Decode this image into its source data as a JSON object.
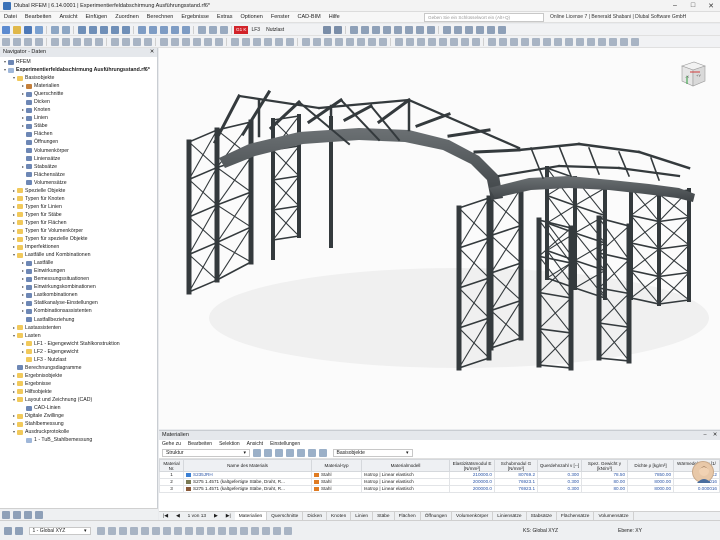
{
  "app": {
    "title": "Dlubal RFEM | 6.14.0001 | Experimentierfeldabschirmung Ausführungsstand.rf6*"
  },
  "menu": {
    "items": [
      "Datei",
      "Bearbeiten",
      "Ansicht",
      "Einfügen",
      "Zuordnen",
      "Berechnen",
      "Ergebnisse",
      "Extras",
      "Optionen",
      "Fenster",
      "CAD-BIM",
      "Hilfe"
    ]
  },
  "search": {
    "placeholder": "Geben Sie ein Schlüsselwort ein (Alt+Q)"
  },
  "license": "Online License 7 | Benerald Shabani | Dlubal Software GmbH",
  "loadcase": {
    "badge": "G1 K",
    "name": "LF3",
    "description": "Nutzlast"
  },
  "navigator": {
    "title": "Navigator - Daten",
    "tree": [
      {
        "label": "RFEM",
        "level": 0,
        "arrow": "v",
        "icon": "gen"
      },
      {
        "label": "Experimentierfeldabschirmung Ausführungsstand.rf6*",
        "level": 0,
        "arrow": "v",
        "icon": "doc",
        "bold": true
      },
      {
        "label": "Basisobjekte",
        "level": 1,
        "arrow": "v",
        "icon": "folder"
      },
      {
        "label": "Materialien",
        "level": 2,
        "arrow": ">",
        "icon": "mat"
      },
      {
        "label": "Querschnitte",
        "level": 2,
        "arrow": ">",
        "icon": "gen"
      },
      {
        "label": "Dicken",
        "level": 2,
        "arrow": "",
        "icon": "gen"
      },
      {
        "label": "Knoten",
        "level": 2,
        "arrow": ">",
        "icon": "gen"
      },
      {
        "label": "Linien",
        "level": 2,
        "arrow": ">",
        "icon": "gen"
      },
      {
        "label": "Stäbe",
        "level": 2,
        "arrow": ">",
        "icon": "gen"
      },
      {
        "label": "Flächen",
        "level": 2,
        "arrow": "",
        "icon": "gen"
      },
      {
        "label": "Öffnungen",
        "level": 2,
        "arrow": "",
        "icon": "gen"
      },
      {
        "label": "Volumenkörper",
        "level": 2,
        "arrow": "",
        "icon": "gen"
      },
      {
        "label": "Liniensätze",
        "level": 2,
        "arrow": "",
        "icon": "gen"
      },
      {
        "label": "Stabsätze",
        "level": 2,
        "arrow": ">",
        "icon": "gen"
      },
      {
        "label": "Flächensätze",
        "level": 2,
        "arrow": "",
        "icon": "gen"
      },
      {
        "label": "Volumensätze",
        "level": 2,
        "arrow": "",
        "icon": "gen"
      },
      {
        "label": "Spezielle Objekte",
        "level": 1,
        "arrow": ">",
        "icon": "folder"
      },
      {
        "label": "Typen für Knoten",
        "level": 1,
        "arrow": ">",
        "icon": "folder"
      },
      {
        "label": "Typen für Linien",
        "level": 1,
        "arrow": ">",
        "icon": "folder"
      },
      {
        "label": "Typen für Stäbe",
        "level": 1,
        "arrow": ">",
        "icon": "folder"
      },
      {
        "label": "Typen für Flächen",
        "level": 1,
        "arrow": ">",
        "icon": "folder"
      },
      {
        "label": "Typen für Volumenkörper",
        "level": 1,
        "arrow": ">",
        "icon": "folder"
      },
      {
        "label": "Typen für spezielle Objekte",
        "level": 1,
        "arrow": ">",
        "icon": "folder"
      },
      {
        "label": "Imperfektionen",
        "level": 1,
        "arrow": ">",
        "icon": "folder"
      },
      {
        "label": "Lastfälle und Kombinationen",
        "level": 1,
        "arrow": "v",
        "icon": "folder"
      },
      {
        "label": "Lastfälle",
        "level": 2,
        "arrow": ">",
        "icon": "gen"
      },
      {
        "label": "Einwirkungen",
        "level": 2,
        "arrow": ">",
        "icon": "gen"
      },
      {
        "label": "Bemessungssituationen",
        "level": 2,
        "arrow": ">",
        "icon": "gen"
      },
      {
        "label": "Einwirkungskombinationen",
        "level": 2,
        "arrow": ">",
        "icon": "gen"
      },
      {
        "label": "Lastkombinationen",
        "level": 2,
        "arrow": ">",
        "icon": "gen"
      },
      {
        "label": "Statikanalyse-Einstellungen",
        "level": 2,
        "arrow": ">",
        "icon": "gen"
      },
      {
        "label": "Kombinationsassistenten",
        "level": 2,
        "arrow": ">",
        "icon": "gen"
      },
      {
        "label": "Lastfallbeziehung",
        "level": 2,
        "arrow": "",
        "icon": "gen"
      },
      {
        "label": "Lastassistenten",
        "level": 1,
        "arrow": ">",
        "icon": "folder"
      },
      {
        "label": "Lasten",
        "level": 1,
        "arrow": "v",
        "icon": "folder"
      },
      {
        "label": "LF1 - Eigengewicht Stahlkonstruktion",
        "level": 2,
        "arrow": ">",
        "icon": "folder"
      },
      {
        "label": "LF2 - Eigengewicht",
        "level": 2,
        "arrow": ">",
        "icon": "folder"
      },
      {
        "label": "LF3 - Nutzlast",
        "level": 2,
        "arrow": "",
        "icon": "folder"
      },
      {
        "label": "Berechnungsdiagramme",
        "level": 1,
        "arrow": "",
        "icon": "gen"
      },
      {
        "label": "Ergebnisobjekte",
        "level": 1,
        "arrow": ">",
        "icon": "folder"
      },
      {
        "label": "Ergebnisse",
        "level": 1,
        "arrow": ">",
        "icon": "folder"
      },
      {
        "label": "Hilfsobjekte",
        "level": 1,
        "arrow": ">",
        "icon": "folder"
      },
      {
        "label": "Layout und Zeichnung (CAD)",
        "level": 1,
        "arrow": "v",
        "icon": "folder"
      },
      {
        "label": "CAD-Linien",
        "level": 2,
        "arrow": "",
        "icon": "gen"
      },
      {
        "label": "Digitale Zwillinge",
        "level": 1,
        "arrow": ">",
        "icon": "folder"
      },
      {
        "label": "Stahlbemessung",
        "level": 1,
        "arrow": ">",
        "icon": "folder"
      },
      {
        "label": "Ausdruckprotokolle",
        "level": 1,
        "arrow": "v",
        "icon": "folder"
      },
      {
        "label": "1 - TuB_Stahlbemessung",
        "level": 2,
        "arrow": "",
        "icon": "doc"
      }
    ],
    "bottom_view": "1 - Global XYZ"
  },
  "materials": {
    "title": "Materialien",
    "menu": [
      "Gehe zu",
      "Bearbeiten",
      "Selektion",
      "Ansicht",
      "Einstellungen"
    ],
    "filter": "Struktur",
    "category": "Basisobjekte",
    "headers": [
      "Material Nr.",
      "Name des Materials",
      "Material-typ",
      "Materialmodell",
      "Elastizitätsmodul E [N/mm²]",
      "Schubmodul G [N/mm²]",
      "Querdehnzahl ν [--]",
      "Spez. Gewicht γ [kN/m³]",
      "Dichte ρ [kg/m³]",
      "Wärmedehnz. α [1/°C]"
    ],
    "rows": [
      {
        "nr": "1",
        "name": "S235JRH",
        "color": "#3a7fd4",
        "type": "Stahl",
        "model": "Isotrop | Linear elastisch",
        "e": "210000.0",
        "g": "80769.2",
        "nu": "0.300",
        "gamma": "78.50",
        "rho": "7850.00",
        "alpha": "0.000012"
      },
      {
        "nr": "2",
        "name": "S275 1.4571 (kaltgefertigte Stäbe, Draht, R...",
        "color": "#7a7a55",
        "type": "Stahl",
        "model": "Isotrop | Linear elastisch",
        "e": "200000.0",
        "g": "76923.1",
        "nu": "0.300",
        "gamma": "80.00",
        "rho": "8000.00",
        "alpha": "0.000016"
      },
      {
        "nr": "3",
        "name": "S275 1.4571 (kaltgefertigte Stäbe, Draht, R...",
        "color": "#8a5a3a",
        "type": "Stahl",
        "model": "Isotrop | Linear elastisch",
        "e": "200000.0",
        "g": "76923.1",
        "nu": "0.300",
        "gamma": "80.00",
        "rho": "8000.00",
        "alpha": "0.000016"
      }
    ],
    "pager": "1 von 13",
    "tabs": [
      "Materialien",
      "Querschnitte",
      "Dicken",
      "Knoten",
      "Linien",
      "Stäbe",
      "Flächen",
      "Öffnungen",
      "Volumenkörper",
      "Liniensätze",
      "Stabsätze",
      "Flächensätze",
      "Volumensätze"
    ]
  },
  "status": {
    "view": "1 - Global XYZ",
    "cs": "KS: Global XYZ",
    "plane": "Ebene: XY"
  },
  "cube": {
    "face_front": "-X",
    "face_right": "+Y"
  }
}
